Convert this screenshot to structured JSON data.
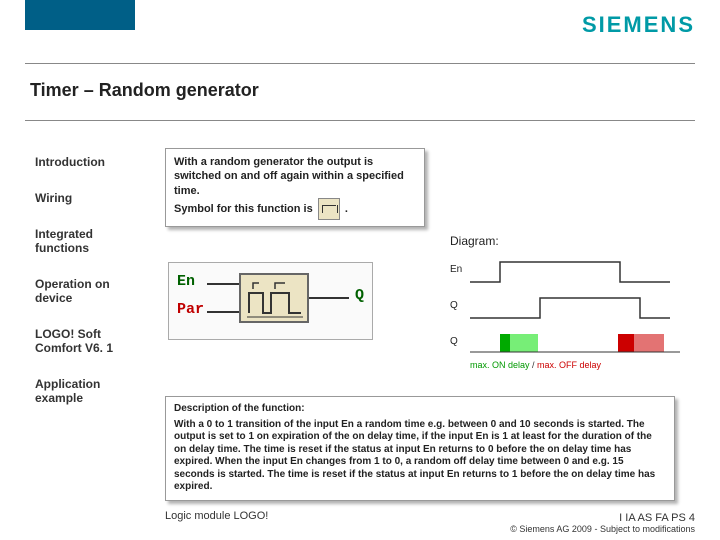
{
  "brand": "SIEMENS",
  "title": "Timer – Random generator",
  "sidebar": {
    "items": [
      "Introduction",
      "Wiring",
      "Integrated functions",
      "Operation on device",
      "LOGO! Soft Comfort V6. 1",
      "Application example"
    ]
  },
  "intro": {
    "line1": "With a random generator the output is switched on and off again within a specified time.",
    "line2a": "Symbol for this function is",
    "line2b": "."
  },
  "diagram_label": "Diagram:",
  "fb": {
    "en": "En",
    "par": "Par",
    "q": "Q"
  },
  "timing": {
    "en_label": "En",
    "q1_label": "Q",
    "q2_label": "Q",
    "legend_on": "max. ON delay",
    "legend_sep": " / ",
    "legend_off": "max. OFF delay"
  },
  "desc": {
    "heading": "Description of the function:",
    "body": "With a 0 to 1 transition of the input En a random time e.g. between 0 and 10 seconds is started. The output is set to 1 on expiration of the on delay time, if the input En is 1 at least for the duration of the on delay time. The time is reset if the status at input En returns to 0 before the on delay time has expired. When the input En changes from 1 to 0, a random off delay time between 0 and e.g. 15 seconds is started. The time is reset if the status at input En returns to 1 before the on delay time has expired."
  },
  "footer": {
    "left": "Logic module LOGO!",
    "right1": "I IA AS FA PS 4",
    "right2": "© Siemens AG 2009 - Subject to modifications"
  }
}
